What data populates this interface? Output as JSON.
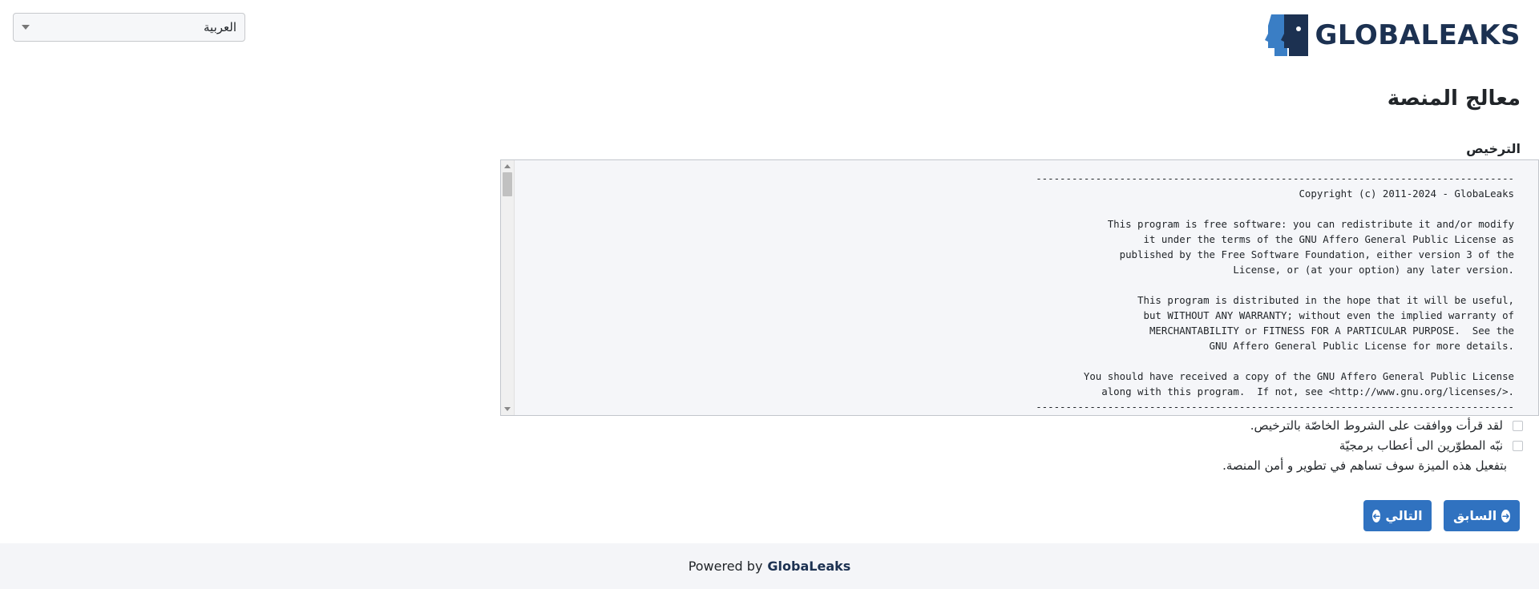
{
  "header": {
    "logo_text": "GLOBALEAKS",
    "language": "العربية"
  },
  "wizard": {
    "title": "معالج المنصة",
    "license_label": "الترخيص",
    "license_text": "--------------------------------------------------------------------------------\nCopyright (c) 2011-2024 - GlobaLeaks\n\nThis program is free software: you can redistribute it and/or modify\nit under the terms of the GNU Affero General Public License as\npublished by the Free Software Foundation, either version 3 of the\nLicense, or (at your option) any later version.\n\nThis program is distributed in the hope that it will be useful,\nbut WITHOUT ANY WARRANTY; without even the implied warranty of\nMERCHANTABILITY or FITNESS FOR A PARTICULAR PURPOSE.  See the\nGNU Affero General Public License for more details.\n\nYou should have received a copy of the GNU Affero General Public License\nalong with this program.  If not, see <http://www.gnu.org/licenses/>.\n--------------------------------------------------------------------------------",
    "accept_label": "لقد قرأت ووافقت على الشروط الخاصّة بالترخيص.",
    "notify_label": "نبّه المطوّرين الى أعطاب برمجيّة",
    "notify_hint": "بتفعيل هذه الميزة سوف تساهم في تطوير و أمن المنصة.",
    "prev_label": "السابق",
    "next_label": "التالي"
  },
  "footer": {
    "powered_by": "Powered by",
    "brand": "GlobaLeaks"
  },
  "colors": {
    "primary": "#3072c0",
    "brand_dark": "#1c3151",
    "logo_blue": "#3a7ec5"
  }
}
